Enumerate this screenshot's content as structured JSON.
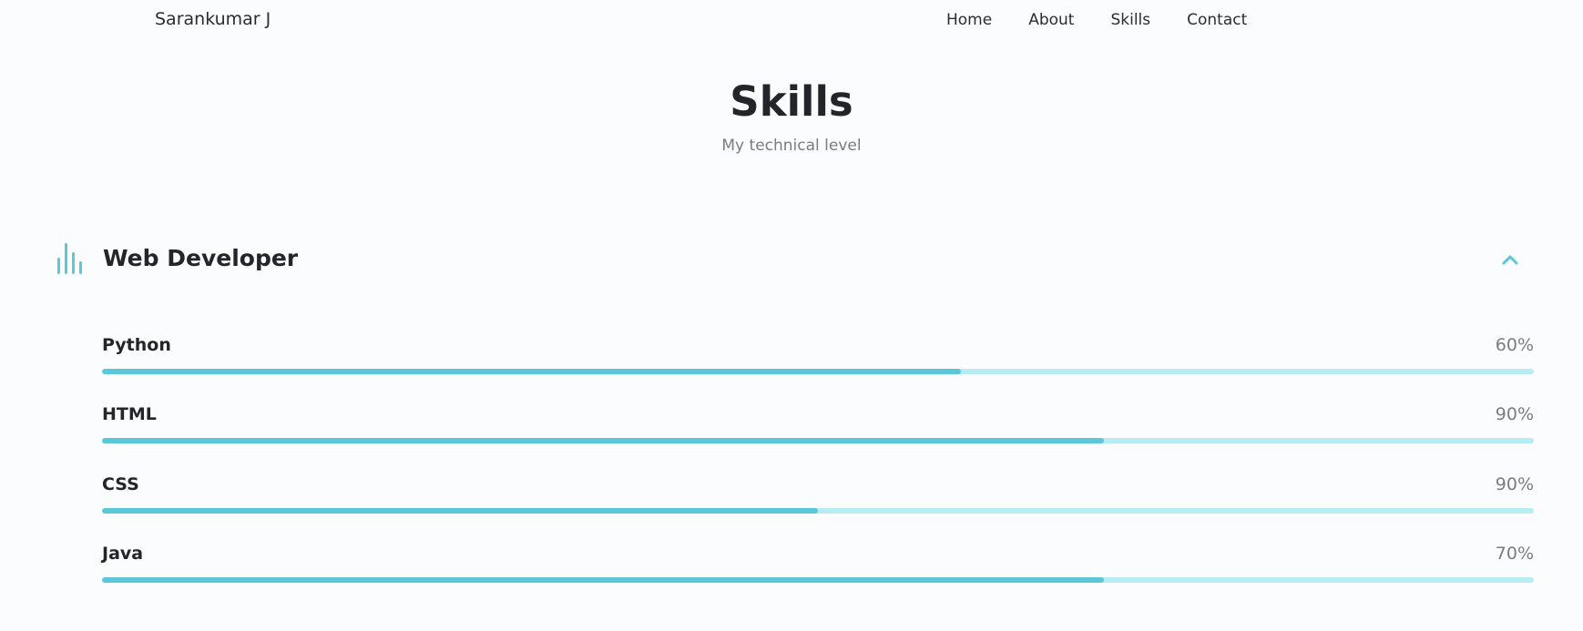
{
  "header": {
    "logo": "Sarankumar J",
    "nav": [
      "Home",
      "About",
      "Skills",
      "Contact"
    ]
  },
  "section": {
    "title": "Skills",
    "subtitle": "My technical level"
  },
  "skills_group": {
    "title": "Web Developer",
    "icon": "bar-chart-icon",
    "toggle_icon": "chevron-up-icon",
    "accent_color": "#5ac8d8",
    "track_color": "#b8ecf5",
    "items": [
      {
        "name": "Python",
        "label": "60%",
        "fill": 0.6
      },
      {
        "name": "HTML",
        "label": "90%",
        "fill": 0.7
      },
      {
        "name": "CSS",
        "label": "90%",
        "fill": 0.5
      },
      {
        "name": "Java",
        "label": "70%",
        "fill": 0.7
      }
    ]
  }
}
